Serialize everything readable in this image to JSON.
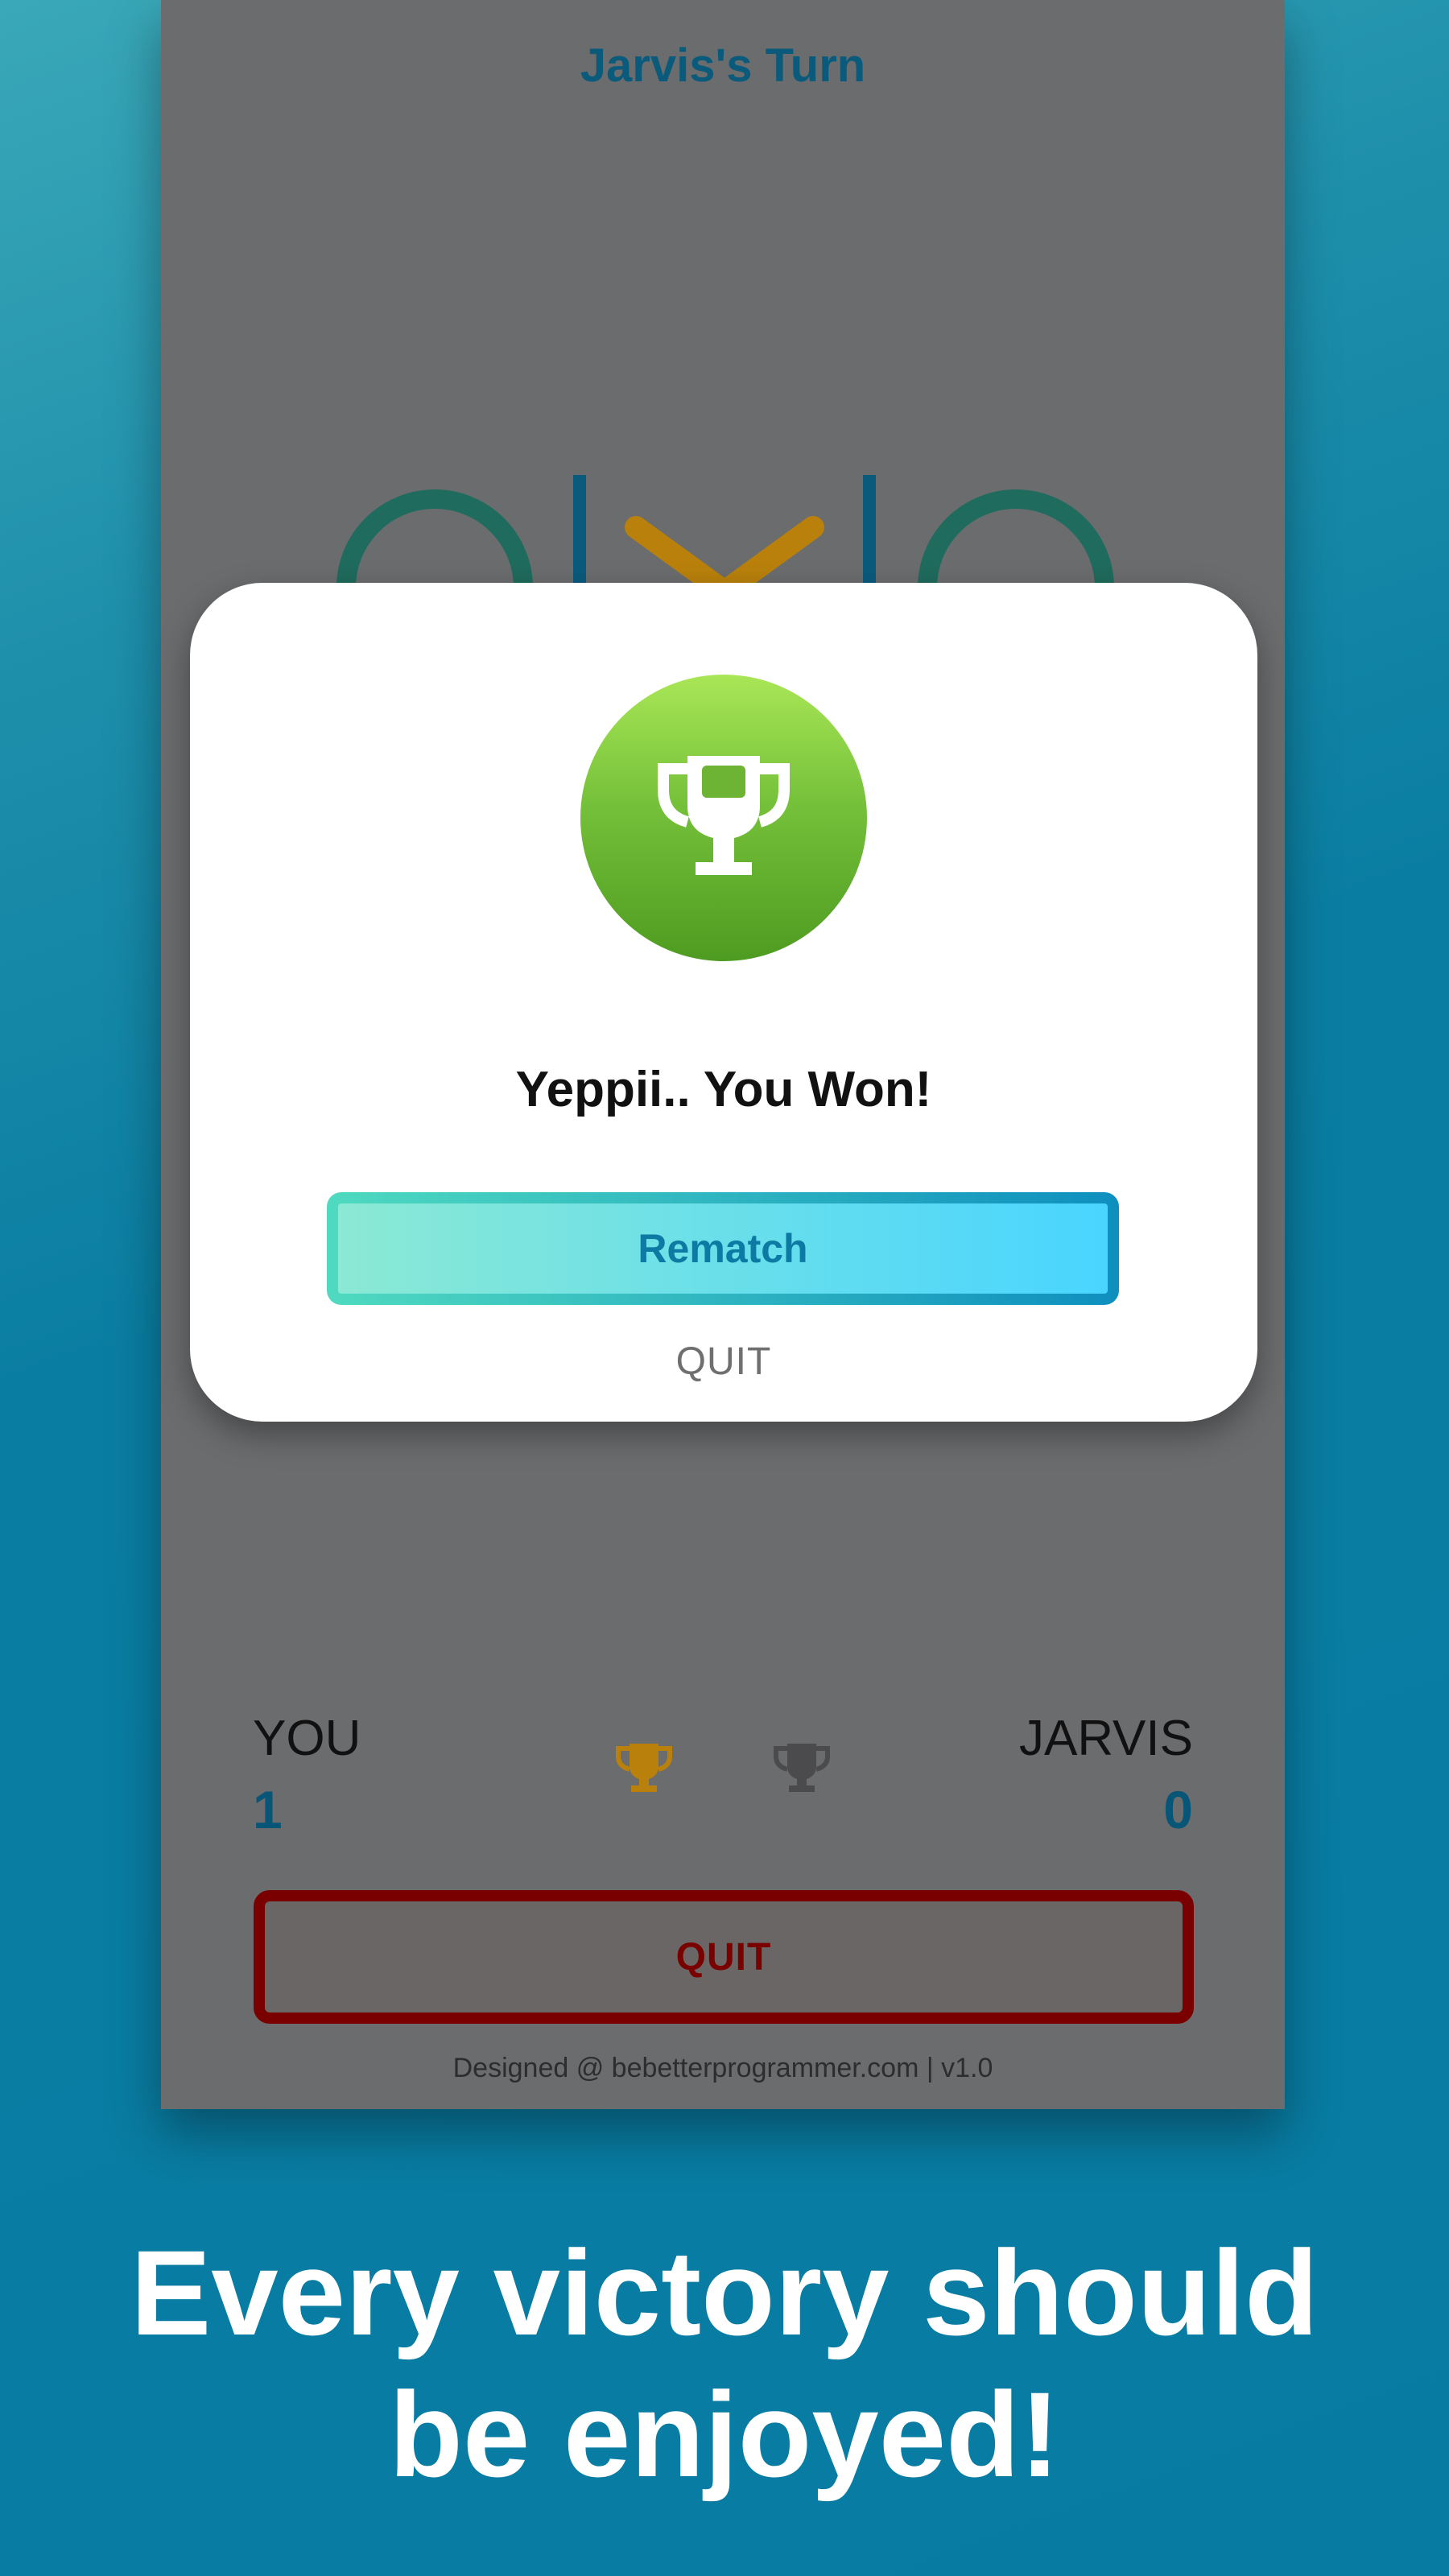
{
  "header": {
    "turn_label": "Jarvis's Turn"
  },
  "scoreboard": {
    "player_label": "YOU",
    "player_score": "1",
    "opponent_label": "JARVIS",
    "opponent_score": "0"
  },
  "actions": {
    "quit_label": "QUIT"
  },
  "footer": {
    "text": "Designed @ bebetterprogrammer.com | v1.0"
  },
  "modal": {
    "icon": "trophy-icon",
    "message": "Yeppii.. You Won!",
    "rematch_label": "Rematch",
    "quit_label": "QUIT"
  },
  "tagline": {
    "line1": "Every victory should",
    "line2": "be enjoyed!"
  },
  "colors": {
    "x_mark": "#b9810b",
    "o_mark": "#1f6b5d",
    "grid_line": "#0a5a7c",
    "quit_red": "#7a0000",
    "accent_blue": "#0c7aa2",
    "trophy_green": "#5fae2c"
  }
}
